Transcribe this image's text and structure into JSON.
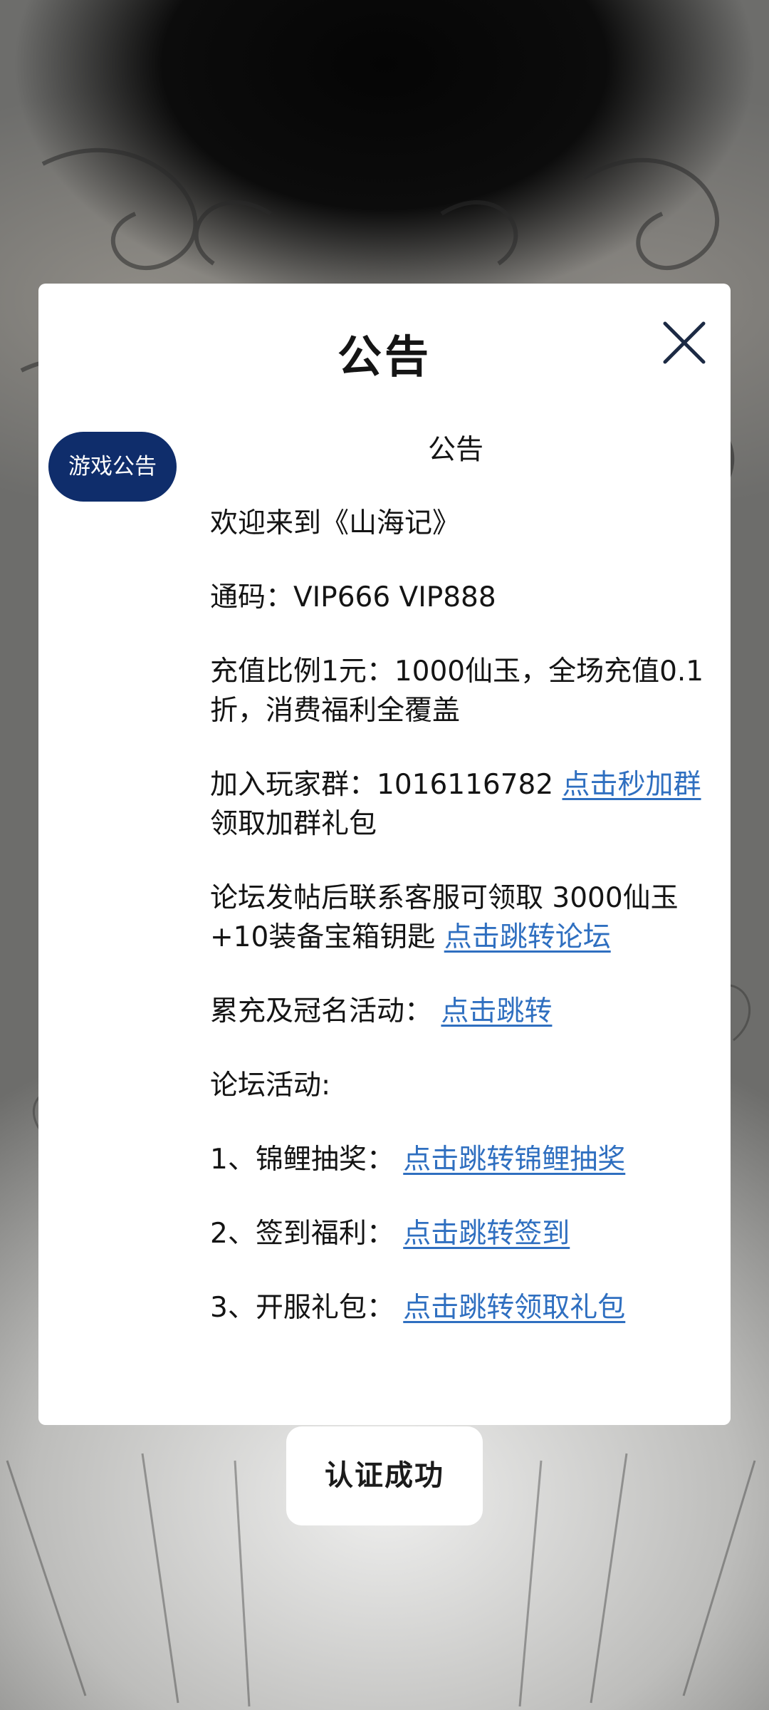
{
  "modal": {
    "title": "公告",
    "close_icon": "close-icon"
  },
  "sidebar": {
    "tab_label": "游戏公告"
  },
  "announcement": {
    "heading": "公告",
    "welcome": "欢迎来到《山海记》",
    "codes": "通码：VIP666 VIP888",
    "recharge": "充值比例1元：1000仙玉，全场充值0.1折，消费福利全覆盖",
    "group_text": "加入玩家群：1016116782 ",
    "group_link": "点击秒加群",
    "group_suffix": " 领取加群礼包",
    "forum_text": "论坛发帖后联系客服可领取 3000仙玉+10装备宝箱钥匙 ",
    "forum_link": "点击跳转论坛",
    "event_text": "累充及冠名活动： ",
    "event_link": "点击跳转",
    "forum_events": "论坛活动:",
    "item1_text": "1、锦鲤抽奖： ",
    "item1_link": "点击跳转锦鲤抽奖",
    "item2_text": "2、签到福利： ",
    "item2_link": "点击跳转签到",
    "item3_text": "3、开服礼包： ",
    "item3_link": "点击跳转领取礼包"
  },
  "toast": {
    "text": "认证成功"
  },
  "colors": {
    "tab_bg": "#0f2d6b",
    "link": "#2f6fc0",
    "modal_bg": "#ffffff"
  }
}
